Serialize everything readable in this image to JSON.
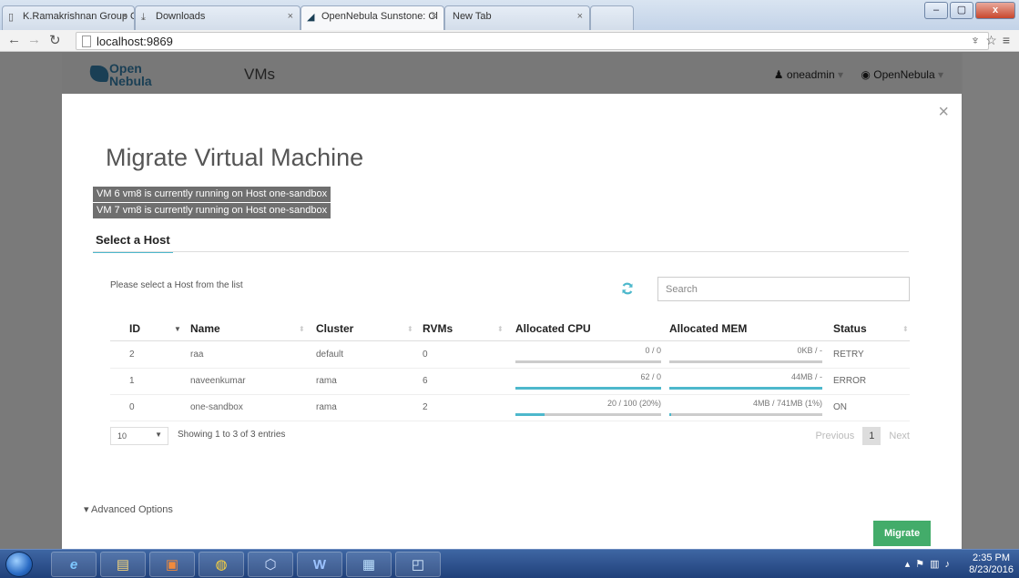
{
  "browser": {
    "tabs": [
      {
        "title": "K.Ramakrishnan Group Of",
        "icon": "page-icon"
      },
      {
        "title": "Downloads",
        "icon": "download-icon"
      },
      {
        "title": "OpenNebula Sunstone: Cl",
        "icon": "opennebula-icon"
      },
      {
        "title": "New Tab",
        "icon": "page-icon"
      }
    ],
    "address": "localhost:9869",
    "window_controls": {
      "minimize": "–",
      "maximize": "▢",
      "close": "x"
    }
  },
  "app": {
    "logo_line1": "Open",
    "logo_line2": "Nebula",
    "section_title": "VMs",
    "user": "oneadmin",
    "zone": "OpenNebula"
  },
  "modal": {
    "close": "×",
    "title": "Migrate Virtual Machine",
    "notices": [
      "VM 6 vm8 is currently running on Host one-sandbox",
      "VM 7 vm8 is currently running on Host one-sandbox"
    ],
    "tab_label": "Select a Host",
    "instruction": "Please select a Host from the list",
    "search_placeholder": "Search",
    "table": {
      "headers": [
        "ID",
        "Name",
        "Cluster",
        "RVMs",
        "Allocated CPU",
        "Allocated MEM",
        "Status"
      ],
      "rows": [
        {
          "id": "2",
          "name": "raa",
          "cluster": "default",
          "rvms": "0",
          "cpu": "0 / 0",
          "cpu_fill": 0,
          "mem": "0KB / -",
          "mem_fill": 0,
          "status": "RETRY"
        },
        {
          "id": "1",
          "name": "naveenkumar",
          "cluster": "rama",
          "rvms": "6",
          "cpu": "62 / 0",
          "cpu_fill": 100,
          "mem": "44MB / -",
          "mem_fill": 100,
          "status": "ERROR"
        },
        {
          "id": "0",
          "name": "one-sandbox",
          "cluster": "rama",
          "rvms": "2",
          "cpu": "20 / 100 (20%)",
          "cpu_fill": 20,
          "mem": "4MB / 741MB (1%)",
          "mem_fill": 1,
          "status": "ON"
        }
      ]
    },
    "page_length": "10",
    "info": "Showing 1 to 3 of 3 entries",
    "pager": {
      "previous": "Previous",
      "current": "1",
      "next": "Next"
    },
    "advanced": "Advanced Options",
    "migrate_label": "Migrate"
  },
  "taskbar": {
    "apps": [
      "ie-icon",
      "explorer-icon",
      "media-player-icon",
      "chrome-icon",
      "virtualbox-icon",
      "word-icon",
      "control-panel-icon",
      "app-icon"
    ],
    "time": "2:35 PM",
    "date": "8/23/2016"
  },
  "colors": {
    "accent": "#4db8cc",
    "migrate": "#43ac6a",
    "logo": "#1a3f55"
  }
}
